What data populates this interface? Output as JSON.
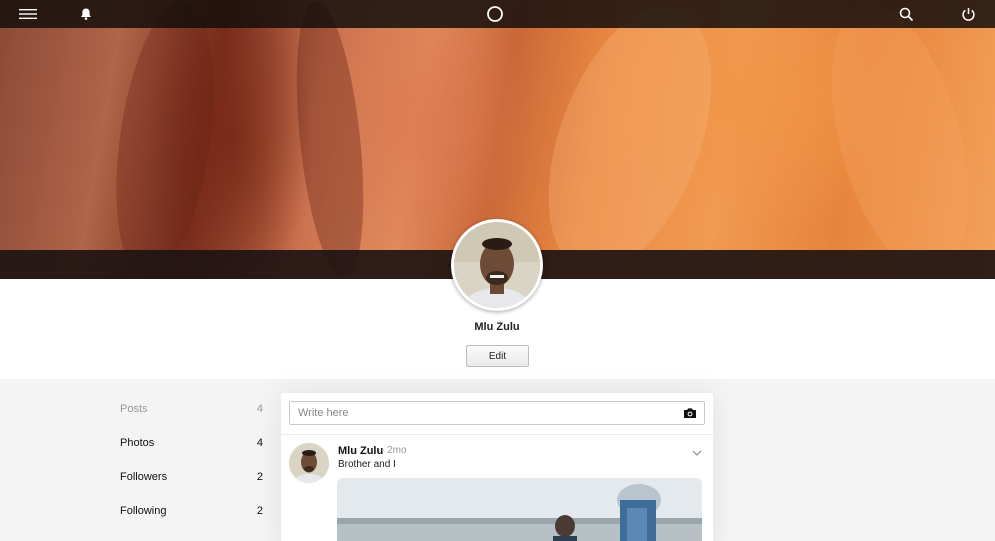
{
  "topbar": {
    "menu_icon": "hamburger-menu-icon",
    "notifications_icon": "bell-icon",
    "home_icon": "circle-logo-icon",
    "search_icon": "search-icon",
    "power_icon": "power-icon"
  },
  "profile": {
    "name": "Mlu Zulu",
    "edit_label": "Edit"
  },
  "stats": [
    {
      "label": "Posts",
      "count": "4"
    },
    {
      "label": "Photos",
      "count": "4"
    },
    {
      "label": "Followers",
      "count": "2"
    },
    {
      "label": "Following",
      "count": "2"
    }
  ],
  "composer": {
    "placeholder": "Write here",
    "camera_icon": "camera-icon"
  },
  "posts": [
    {
      "author": "Mlu Zulu",
      "time": "- 2mo",
      "text": "Brother and I",
      "menu_icon": "chevron-down-icon"
    }
  ]
}
